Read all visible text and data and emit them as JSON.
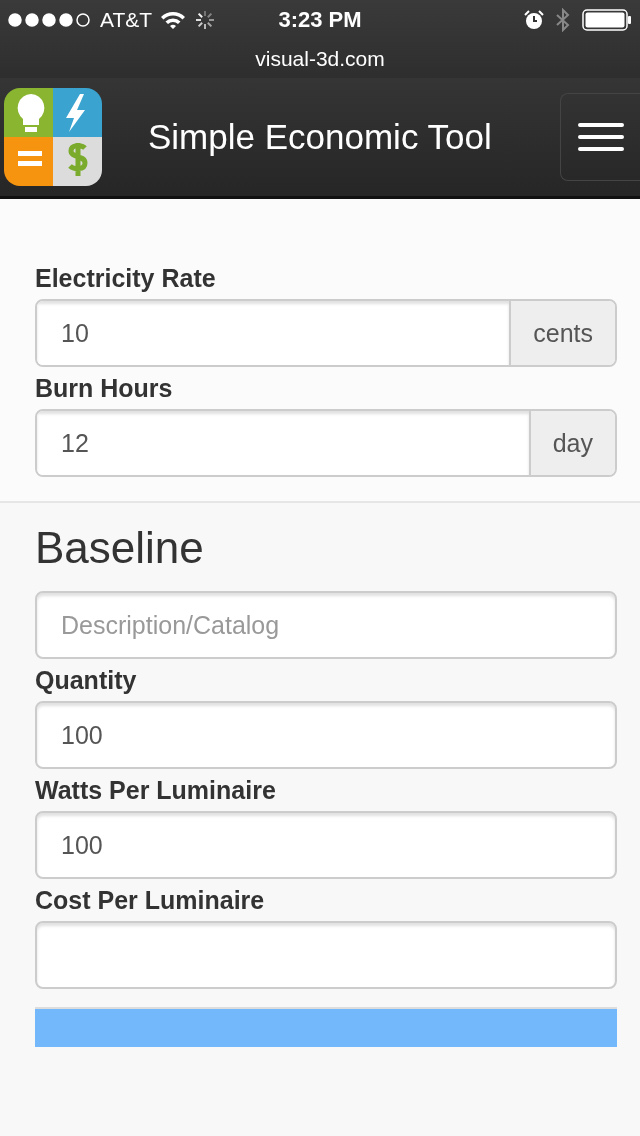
{
  "status_bar": {
    "carrier": "AT&T",
    "time": "3:23 PM"
  },
  "url_bar": {
    "url": "visual-3d.com"
  },
  "navbar": {
    "title": "Simple Economic Tool"
  },
  "settings": [
    {
      "label": "Electricity Rate",
      "value": "10",
      "addon": "cents"
    },
    {
      "label": "Burn Hours",
      "value": "12",
      "addon": "day"
    }
  ],
  "baseline": {
    "heading": "Baseline",
    "fields": [
      {
        "placeholder": "Description/Catalog"
      },
      {
        "label": "Quantity",
        "value": "100"
      },
      {
        "label": "Watts Per Luminaire",
        "value": "100"
      },
      {
        "label": "Cost Per Luminaire"
      }
    ]
  }
}
